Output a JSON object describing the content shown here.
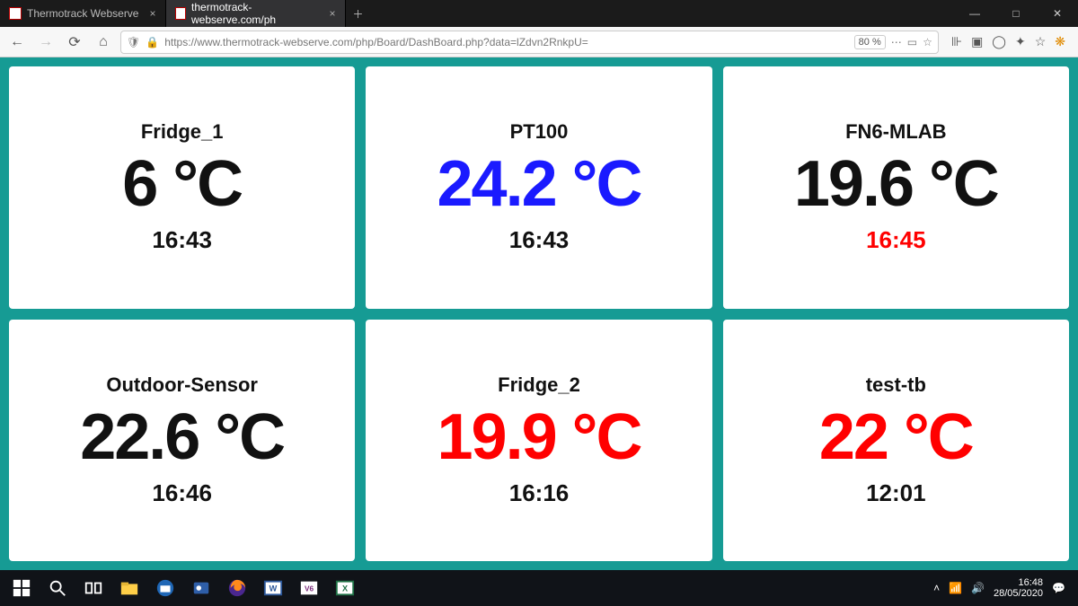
{
  "browser": {
    "tabs": [
      {
        "title": "Thermotrack Webserve",
        "active": false
      },
      {
        "title": "thermotrack-webserve.com/ph",
        "active": true
      }
    ],
    "url": "https://www.thermotrack-webserve.com/php/Board/DashBoard.php?data=lZdvn2RnkpU=",
    "zoom": "80 %"
  },
  "dashboard": {
    "cards": [
      {
        "name": "Fridge_1",
        "value": "6 °C",
        "value_color": "c-black",
        "time": "16:43",
        "time_color": "c-black"
      },
      {
        "name": "PT100",
        "value": "24.2 °C",
        "value_color": "c-blue",
        "time": "16:43",
        "time_color": "c-black"
      },
      {
        "name": "FN6-MLAB",
        "value": "19.6 °C",
        "value_color": "c-black",
        "time": "16:45",
        "time_color": "c-red"
      },
      {
        "name": "Outdoor-Sensor",
        "value": "22.6 °C",
        "value_color": "c-black",
        "time": "16:46",
        "time_color": "c-black"
      },
      {
        "name": "Fridge_2",
        "value": "19.9 °C",
        "value_color": "c-red",
        "time": "16:16",
        "time_color": "c-black"
      },
      {
        "name": "test-tb",
        "value": "22 °C",
        "value_color": "c-red",
        "time": "12:01",
        "time_color": "c-black"
      }
    ]
  },
  "taskbar": {
    "time": "16:48",
    "date": "28/05/2020"
  }
}
